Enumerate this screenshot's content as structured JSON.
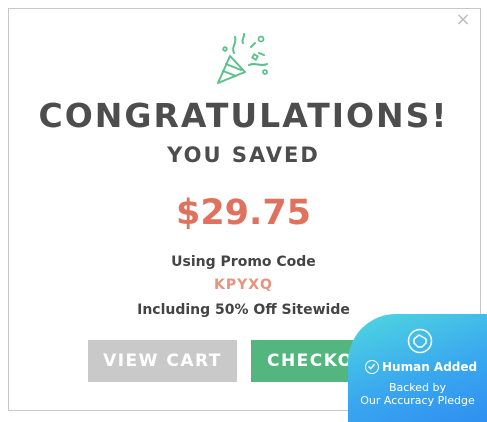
{
  "modal": {
    "close_icon": "close-icon",
    "illustration_icon": "party-popper-icon",
    "title": "CONGRATULATIONS!",
    "subtitle": "YOU SAVED",
    "amount": "$29.75",
    "using_text": "Using Promo Code",
    "promo_code": "KPYXQ",
    "including_text": "Including 50% Off Sitewide",
    "buttons": {
      "view_cart": "VIEW CART",
      "checkout": "CHECKOUT"
    }
  },
  "badge": {
    "icon": "hand-heart-icon",
    "check_icon": "check-circle-icon",
    "title": "Human Added",
    "line1": "Backed by",
    "line2": "Our Accuracy Pledge"
  },
  "colors": {
    "accent_green": "#54b67f",
    "accent_salmon": "#e0715e",
    "button_grey": "#c9c9c9",
    "badge_blue": "#3aa9ef"
  }
}
